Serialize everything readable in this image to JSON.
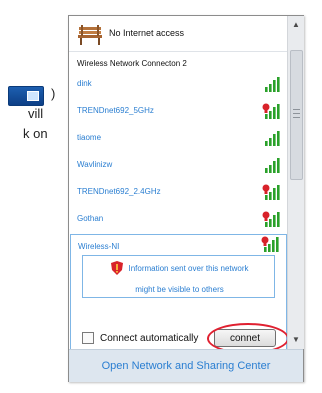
{
  "page_text": {
    "line1_suffix": ")",
    "line2": "vill",
    "line3": "k on"
  },
  "header": {
    "status": "No Internet access",
    "icon": "bench-icon"
  },
  "section_title": "Wireless Network Connecton 2",
  "networks": [
    {
      "name": "dink",
      "secured": false
    },
    {
      "name": "TRENDnet692_5GHz",
      "secured": true
    },
    {
      "name": "tiaome",
      "secured": false
    },
    {
      "name": "Wavlinizw",
      "secured": false
    },
    {
      "name": "TRENDnet692_2.4GHz",
      "secured": true
    },
    {
      "name": "Gothan",
      "secured": true
    }
  ],
  "expanded_network": {
    "name": "Wireless-NI",
    "secured": true,
    "info_line1": "Information sent over this network",
    "info_line2": "might be visible to others",
    "auto_connect_label": "Connect automatically",
    "auto_connect_checked": false,
    "connect_label": "connet"
  },
  "footer": {
    "link": "Open Network and Sharing Center"
  },
  "scrollbar": {
    "up": "▲",
    "down": "▼"
  },
  "colors": {
    "link_blue": "#2a7ed1",
    "signal_green": "#2aa12a",
    "lock_red": "#d8222a",
    "highlight_red": "#e02030"
  }
}
